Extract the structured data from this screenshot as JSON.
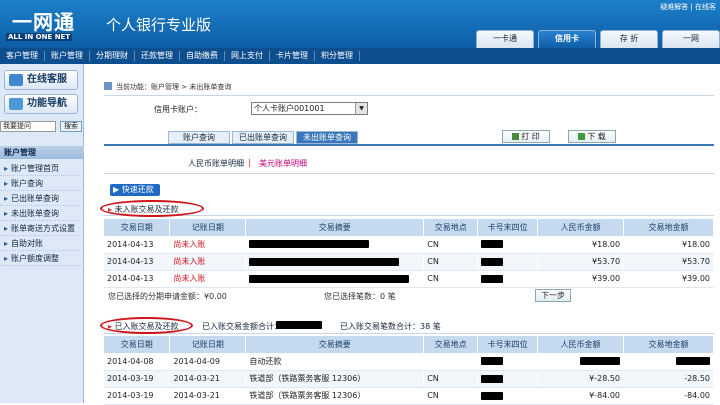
{
  "brand": {
    "logo_cn": "一网通",
    "logo_en": "ALL IN ONE NET",
    "title": "个人银行专业版",
    "top_links": "疑难解答 | 在线客"
  },
  "top_tabs": [
    {
      "label": "一卡通"
    },
    {
      "label": "信用卡"
    },
    {
      "label": "存 折"
    },
    {
      "label": "一网"
    }
  ],
  "menu": [
    "客户管理",
    "账户管理",
    "分期理财",
    "还款管理",
    "自助缴费",
    "网上支付",
    "卡片管理",
    "积分管理"
  ],
  "sidebar": {
    "online_service": "在线客服",
    "nav_button": "功能导航",
    "search_placeholder": "我要提问",
    "search_button": "搜索",
    "section": "账户管理",
    "items": [
      "账户管理首页",
      "账户查询",
      "已出账单查询",
      "未出账单查询",
      "账单寄送方式设置",
      "自助对账",
      "账户额度调整"
    ]
  },
  "breadcrumb": "当前功能：账户管理 > 未出账单查询",
  "card": {
    "label": "信用卡账户：",
    "value": "个人卡账户001001"
  },
  "sub_tabs": [
    "账户查询",
    "已出账单查询",
    "未出账单查询"
  ],
  "actions": {
    "print": "打 印",
    "download": "下 载"
  },
  "currency": {
    "rmb": "人民币账单明细",
    "usd": "美元账单明细",
    "sep": "|"
  },
  "quick_pay": "快速还款",
  "table_headers": [
    "交易日期",
    "记账日期",
    "交易摘要",
    "交易地点",
    "卡号末四位",
    "人民币金额",
    "交易地金额"
  ],
  "unposted": {
    "title": "未入账交易及还款",
    "rows": [
      {
        "date": "2014-04-13",
        "post": "尚未入账",
        "place": "CN",
        "rmb": "¥18.00",
        "local": "¥18.00"
      },
      {
        "date": "2014-04-13",
        "post": "尚未入账",
        "place": "CN",
        "rmb": "¥53.70",
        "local": "¥53.70"
      },
      {
        "date": "2014-04-13",
        "post": "尚未入账",
        "place": "CN",
        "rmb": "¥39.00",
        "local": "¥39.00"
      }
    ],
    "installment_total": "您已选择的分期申请金额：¥0.00",
    "selected_count": "您已选择笔数：0 笔",
    "next": "下一步"
  },
  "posted": {
    "title": "已入账交易及还款",
    "amount_total": "已入账交易金额合计：",
    "count_total": "已入账交易笔数合计：38 笔",
    "rows": [
      {
        "date": "2014-04-08",
        "post": "2014-04-09",
        "desc": "自动还款",
        "place": "",
        "rmb": "",
        "local": ""
      },
      {
        "date": "2014-03-19",
        "post": "2014-03-21",
        "desc": "铁道部（铁路票务客服 12306）",
        "place": "CN",
        "rmb": "¥-28.50",
        "local": "-28.50"
      },
      {
        "date": "2014-03-19",
        "post": "2014-03-21",
        "desc": "铁道部（铁路票务客服 12306）",
        "place": "CN",
        "rmb": "¥-84.00",
        "local": "-84.00"
      }
    ]
  },
  "colors": {
    "header_blue": "#1c7fc9",
    "menu_dark": "#0d4e8f",
    "table_head": "#c5d9ef",
    "red": "#d0141b"
  }
}
